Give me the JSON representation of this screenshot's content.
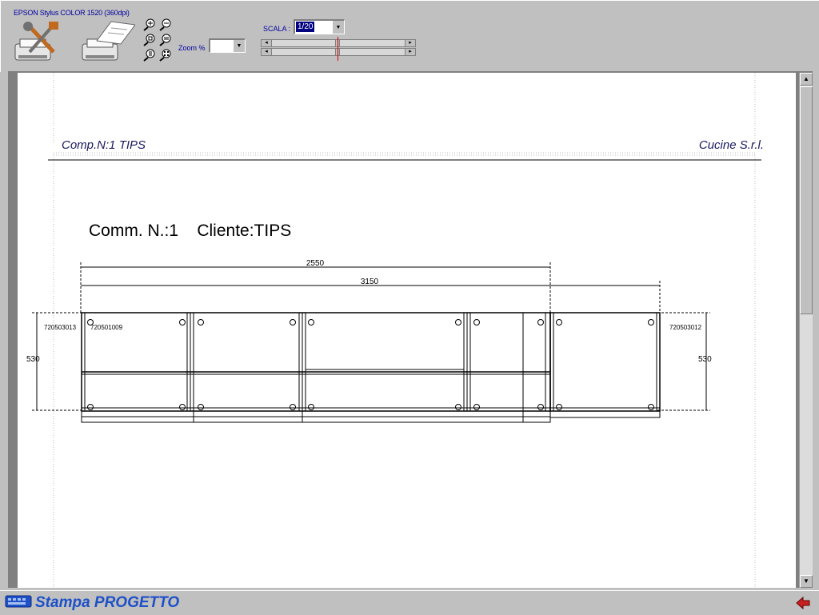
{
  "toolbar": {
    "printer_name": "EPSON Stylus COLOR 1520 (360dpi)",
    "zoom_label": "Zoom %",
    "zoom_value": "",
    "scala_label": "SCALA :",
    "scala_value": "1/20"
  },
  "page": {
    "header_left": "Comp.N:1  TIPS",
    "header_right": "Cucine S.r.l.",
    "commission": "Comm. N.:1    Cliente:TIPS",
    "dim_top_1": "2550",
    "dim_top_2": "3150",
    "dim_left_height": "530",
    "dim_right_height": "530",
    "code_left": "720503013",
    "code_module_1": "720501009",
    "code_right": "720503012"
  },
  "status": {
    "title": "Stampa PROGETTO"
  }
}
